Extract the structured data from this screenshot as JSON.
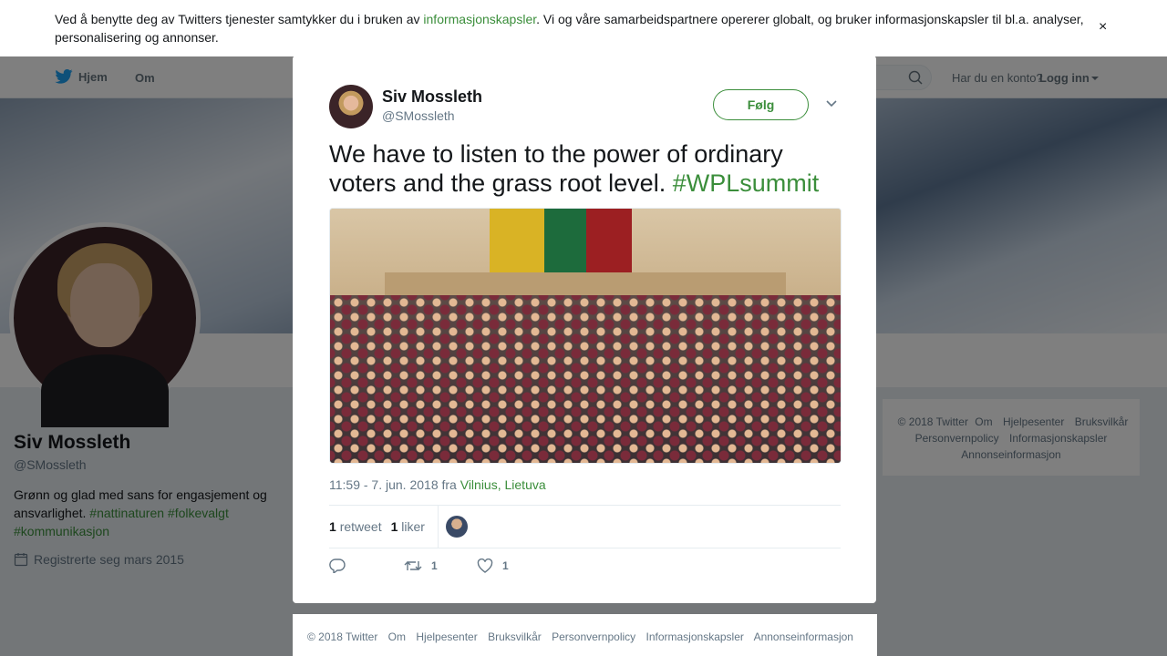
{
  "cookie_bar": {
    "text_before": "Ved å benytte deg av Twitters tjenester samtykker du i bruken av ",
    "link": "informasjonskapsler",
    "text_after": ". Vi og våre samarbeidspartnere opererer globalt, og bruker informasjonskapsler til bl.a. analyser, personalisering og annonser.",
    "close_symbol": "×"
  },
  "overlay_close_symbol": "✕",
  "nav": {
    "home": "Hjem",
    "about": "Om",
    "login_question": "Har du en konto?",
    "login_link": "Logg inn"
  },
  "profile": {
    "name": "Siv Mossleth",
    "handle": "@SMossleth",
    "bio_text": "Grønn og glad med sans for engasjement og ansvarlighet. ",
    "bio_hashtags": [
      "#nattinaturen",
      "#folkevalgt",
      "#kommunikasjon"
    ],
    "joined": "Registrerte seg mars 2015"
  },
  "side_footer": [
    "© 2018 Twitter",
    "Om",
    "Hjelpesenter",
    "Bruksvilkår",
    "Personvernpolicy",
    "Informasjonskapsler",
    "Annonseinformasjon"
  ],
  "tweet": {
    "author_name": "Siv Mossleth",
    "author_handle": "@SMossleth",
    "follow_label": "Følg",
    "text": "We have to listen to the power of ordinary voters and the grass root level. ",
    "hashtag": "#WPLsummit",
    "time": "11:59 - 7. jun. 2018 fra ",
    "location": "Vilnius, Lietuva",
    "retweets_count": "1",
    "retweets_label": "retweet",
    "likes_count": "1",
    "likes_label": "liker",
    "action_retweet_count": "1",
    "action_like_count": "1"
  },
  "modal_footer": [
    "© 2018 Twitter",
    "Om",
    "Hjelpesenter",
    "Bruksvilkår",
    "Personvernpolicy",
    "Informasjonskapsler",
    "Annonseinformasjon"
  ],
  "icons": {
    "twitter": "twitter-bird-icon",
    "search": "search-icon",
    "calendar": "calendar-icon",
    "chevron": "chevron-down-icon",
    "reply": "reply-icon",
    "retweet": "retweet-icon",
    "like": "heart-icon"
  },
  "colors": {
    "accent_green": "#3b8e3b",
    "twitter_blue": "#1da1f2",
    "text_primary": "#14171a",
    "text_secondary": "#657786"
  }
}
